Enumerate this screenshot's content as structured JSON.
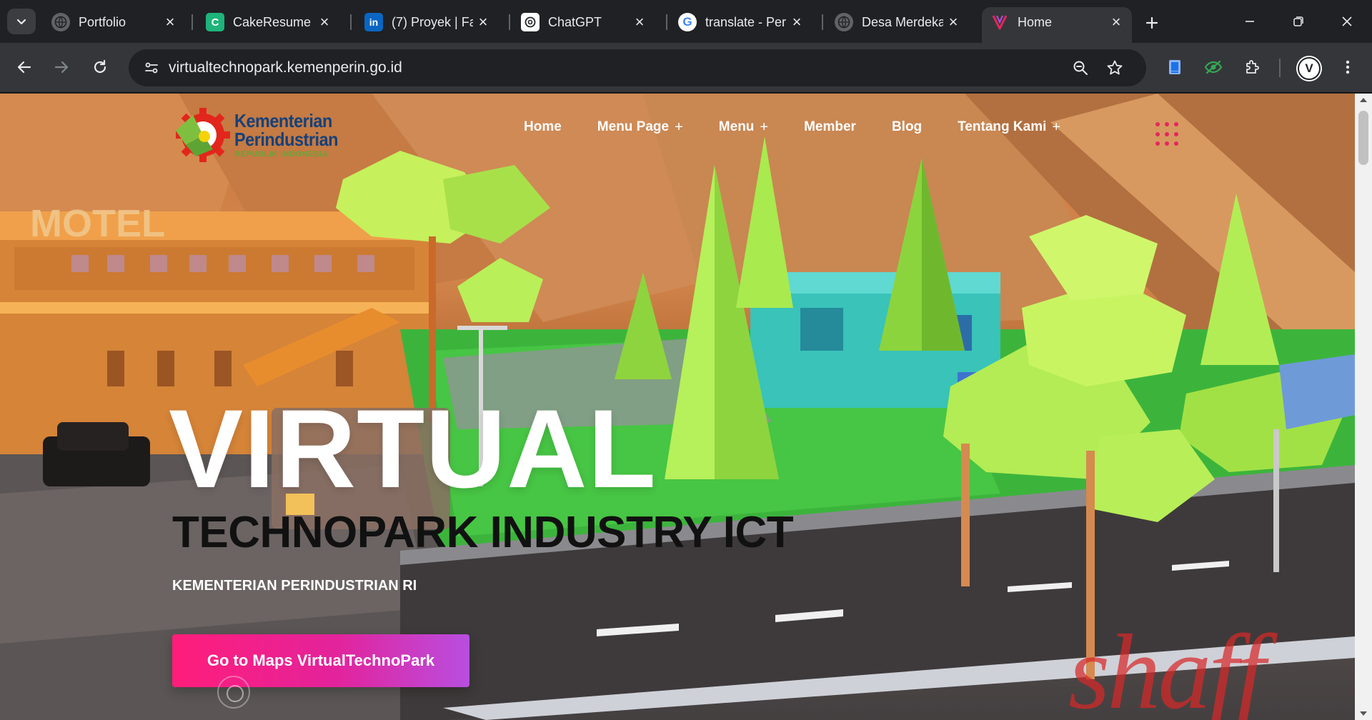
{
  "browser": {
    "tabs": [
      {
        "title": "Portfolio",
        "icon": "globe-icon"
      },
      {
        "title": "CakeResume",
        "icon": "cakeresume-icon"
      },
      {
        "title": "(7) Proyek | Fa",
        "icon": "linkedin-icon"
      },
      {
        "title": "ChatGPT",
        "icon": "chatgpt-icon"
      },
      {
        "title": "translate - Per",
        "icon": "google-icon"
      },
      {
        "title": "Desa Merdeka",
        "icon": "globe-icon"
      },
      {
        "title": "Home",
        "icon": "site-v-icon",
        "active": true
      }
    ],
    "url": "virtualtechnopark.kemenperin.go.id",
    "profile_initial": "V"
  },
  "site": {
    "logo": {
      "line1": "Kementerian",
      "line2": "Perindustrian",
      "line3": "REPUBLIK INDONESIA"
    },
    "nav": [
      {
        "label": "Home",
        "has_submenu": false
      },
      {
        "label": "Menu Page",
        "has_submenu": true
      },
      {
        "label": "Menu",
        "has_submenu": true
      },
      {
        "label": "Member",
        "has_submenu": false
      },
      {
        "label": "Blog",
        "has_submenu": false
      },
      {
        "label": "Tentang Kami",
        "has_submenu": true
      }
    ],
    "submenu_marker": "+"
  },
  "hero": {
    "title": "VIRTUAL",
    "subtitle": "TECHNOPARK INDUSTRY ICT",
    "org": "KEMENTERIAN PERINDUSTRIAN RI",
    "cta_label": "Go to Maps VirtualTechnoPark"
  },
  "scene": {
    "motel_sign": "MOTEL",
    "watermark": "shaff"
  },
  "colors": {
    "accent": "#e6265f",
    "cta_start": "#ff1d7a",
    "cta_end": "#b84ee0",
    "logo_blue": "#16407a",
    "logo_green": "#6aa33a"
  }
}
